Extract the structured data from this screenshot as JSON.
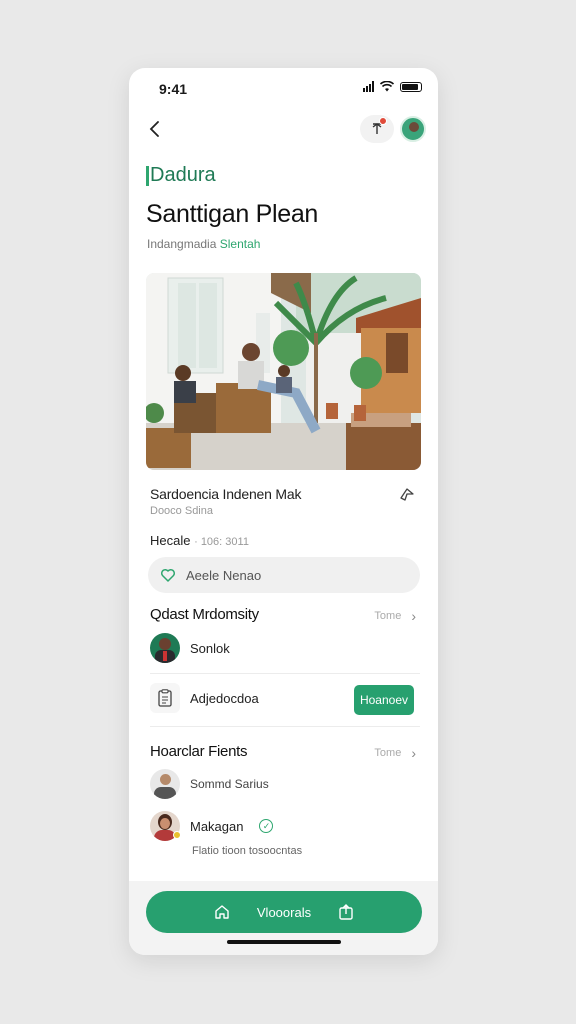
{
  "status": {
    "time": "9:41"
  },
  "brand": {
    "name": "Dadura"
  },
  "page": {
    "title": "Santtigan Plean",
    "subtitle_prefix": "Indangmadia",
    "subtitle_accent": "Slentah"
  },
  "listing": {
    "title": "Sardoencia Indenen Mak",
    "sub": "Dooco Sdina"
  },
  "meta": {
    "label": "Hecale",
    "value": "· 106: 3011"
  },
  "field": {
    "value": "Aeele Nenao"
  },
  "section1": {
    "title": "Qdast Mrdomsity",
    "more": "Tome",
    "items": [
      {
        "name": "Sonlok"
      },
      {
        "name": "Adjedocdoa",
        "button": "Hoanoev"
      }
    ]
  },
  "section2": {
    "title": "Hoarclar Fients",
    "more": "Tome",
    "items": [
      {
        "name": "Sommd Sarius"
      },
      {
        "name": "Makagan",
        "desc": "Flatio tioon tosoocntas"
      }
    ]
  },
  "bottom": {
    "label": "Vlooorals"
  },
  "colors": {
    "accent": "#27a06f",
    "background": "#e9e9e9"
  },
  "icons": [
    "back-icon",
    "upload-icon",
    "share-icon",
    "heart-icon",
    "document-icon",
    "home-icon",
    "export-icon",
    "verified-icon"
  ]
}
